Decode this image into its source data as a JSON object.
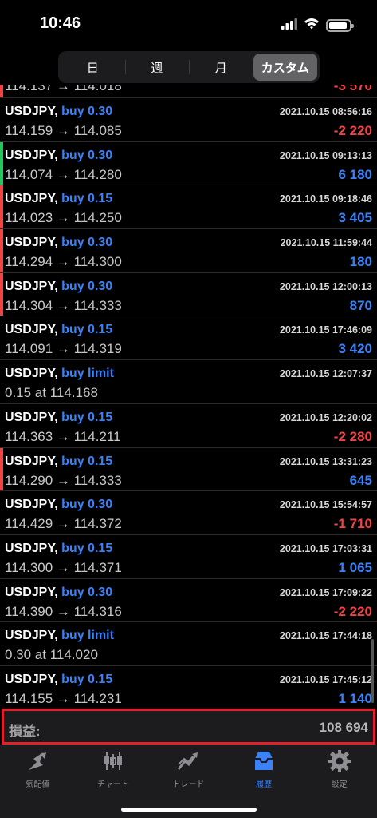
{
  "status": {
    "time": "10:46",
    "battery_level": 0.9
  },
  "period_tabs": [
    {
      "label": "日",
      "active": false
    },
    {
      "label": "週",
      "active": false
    },
    {
      "label": "月",
      "active": false
    },
    {
      "label": "カスタム",
      "active": true
    }
  ],
  "colors": {
    "profit_positive": "#3b82f6",
    "profit_negative": "#ef4444",
    "bar_green": "#22c55e",
    "bar_red": "#ef4444",
    "highlight": "#e0202a"
  },
  "deals": [
    {
      "symbol": "USDJPY,",
      "type": "buy 0.30",
      "date": "2021.10.15 08:56:16",
      "prices": "114.159 → 114.085",
      "profit": "-2 220",
      "sign": "neg",
      "bar": ""
    },
    {
      "symbol": "USDJPY,",
      "type": "buy 0.30",
      "date": "2021.10.15 09:13:13",
      "prices": "114.074 → 114.280",
      "profit": "6 180",
      "sign": "pos",
      "bar": "green"
    },
    {
      "symbol": "USDJPY,",
      "type": "buy 0.15",
      "date": "2021.10.15 09:18:46",
      "prices": "114.023 → 114.250",
      "profit": "3 405",
      "sign": "pos",
      "bar": "red"
    },
    {
      "symbol": "USDJPY,",
      "type": "buy 0.30",
      "date": "2021.10.15 11:59:44",
      "prices": "114.294 → 114.300",
      "profit": "180",
      "sign": "pos",
      "bar": "red"
    },
    {
      "symbol": "USDJPY,",
      "type": "buy 0.30",
      "date": "2021.10.15 12:00:13",
      "prices": "114.304 → 114.333",
      "profit": "870",
      "sign": "pos",
      "bar": "red"
    },
    {
      "symbol": "USDJPY,",
      "type": "buy 0.15",
      "date": "2021.10.15 17:46:09",
      "prices": "114.091 → 114.319",
      "profit": "3 420",
      "sign": "pos",
      "bar": ""
    },
    {
      "symbol": "USDJPY,",
      "type": "buy limit",
      "date": "2021.10.15 12:07:37",
      "prices": "0.15 at 114.168",
      "profit": "",
      "sign": "",
      "bar": ""
    },
    {
      "symbol": "USDJPY,",
      "type": "buy 0.15",
      "date": "2021.10.15 12:20:02",
      "prices": "114.363 → 114.211",
      "profit": "-2 280",
      "sign": "neg",
      "bar": ""
    },
    {
      "symbol": "USDJPY,",
      "type": "buy 0.15",
      "date": "2021.10.15 13:31:23",
      "prices": "114.290 → 114.333",
      "profit": "645",
      "sign": "pos",
      "bar": "red"
    },
    {
      "symbol": "USDJPY,",
      "type": "buy 0.30",
      "date": "2021.10.15 15:54:57",
      "prices": "114.429 → 114.372",
      "profit": "-1 710",
      "sign": "neg",
      "bar": ""
    },
    {
      "symbol": "USDJPY,",
      "type": "buy 0.15",
      "date": "2021.10.15 17:03:31",
      "prices": "114.300 → 114.371",
      "profit": "1 065",
      "sign": "pos",
      "bar": ""
    },
    {
      "symbol": "USDJPY,",
      "type": "buy 0.30",
      "date": "2021.10.15 17:09:22",
      "prices": "114.390 → 114.316",
      "profit": "-2 220",
      "sign": "neg",
      "bar": ""
    },
    {
      "symbol": "USDJPY,",
      "type": "buy limit",
      "date": "2021.10.15 17:44:18",
      "prices": "0.30 at 114.020",
      "profit": "",
      "sign": "",
      "bar": ""
    },
    {
      "symbol": "USDJPY,",
      "type": "buy 0.15",
      "date": "2021.10.15 17:45:12",
      "prices": "114.155 → 114.231",
      "profit": "1 140",
      "sign": "pos",
      "bar": ""
    }
  ],
  "total": {
    "label": "損益:",
    "value": "108 694"
  },
  "tabbar": [
    {
      "label": "気配値",
      "icon": "quotes-icon",
      "active": false
    },
    {
      "label": "チャート",
      "icon": "chart-icon",
      "active": false
    },
    {
      "label": "トレード",
      "icon": "trade-icon",
      "active": false
    },
    {
      "label": "履歴",
      "icon": "history-icon",
      "active": true
    },
    {
      "label": "設定",
      "icon": "settings-icon",
      "active": false
    }
  ]
}
